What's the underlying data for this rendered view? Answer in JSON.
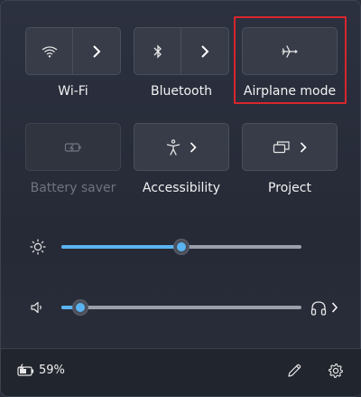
{
  "tiles": {
    "wifi": {
      "label": "Wi-Fi",
      "icon": "wifi-icon",
      "expand_icon": "chevron-right-icon"
    },
    "bluetooth": {
      "label": "Bluetooth",
      "icon": "bluetooth-icon",
      "expand_icon": "chevron-right-icon"
    },
    "airplane": {
      "label": "Airplane mode",
      "icon": "airplane-icon"
    },
    "battery_saver": {
      "label": "Battery saver",
      "icon": "battery-saver-icon",
      "state": "disabled"
    },
    "accessibility": {
      "label": "Accessibility",
      "icon": "accessibility-icon",
      "expand_icon": "chevron-right-icon"
    },
    "project": {
      "label": "Project",
      "icon": "project-icon",
      "expand_icon": "chevron-right-icon"
    }
  },
  "sliders": {
    "brightness": {
      "icon": "brightness-icon",
      "level": 0.5
    },
    "volume": {
      "icon": "speaker-icon",
      "level": 0.08,
      "output_icon": "headphones-icon"
    }
  },
  "footer": {
    "battery_percent": "59%",
    "battery_icon": "battery-charging-icon",
    "edit_icon": "pencil-icon",
    "settings_icon": "gear-icon"
  },
  "colors": {
    "accent": "#5ab3f0",
    "highlight_box": "#d7262d",
    "disabled_text": "#6f7480"
  }
}
